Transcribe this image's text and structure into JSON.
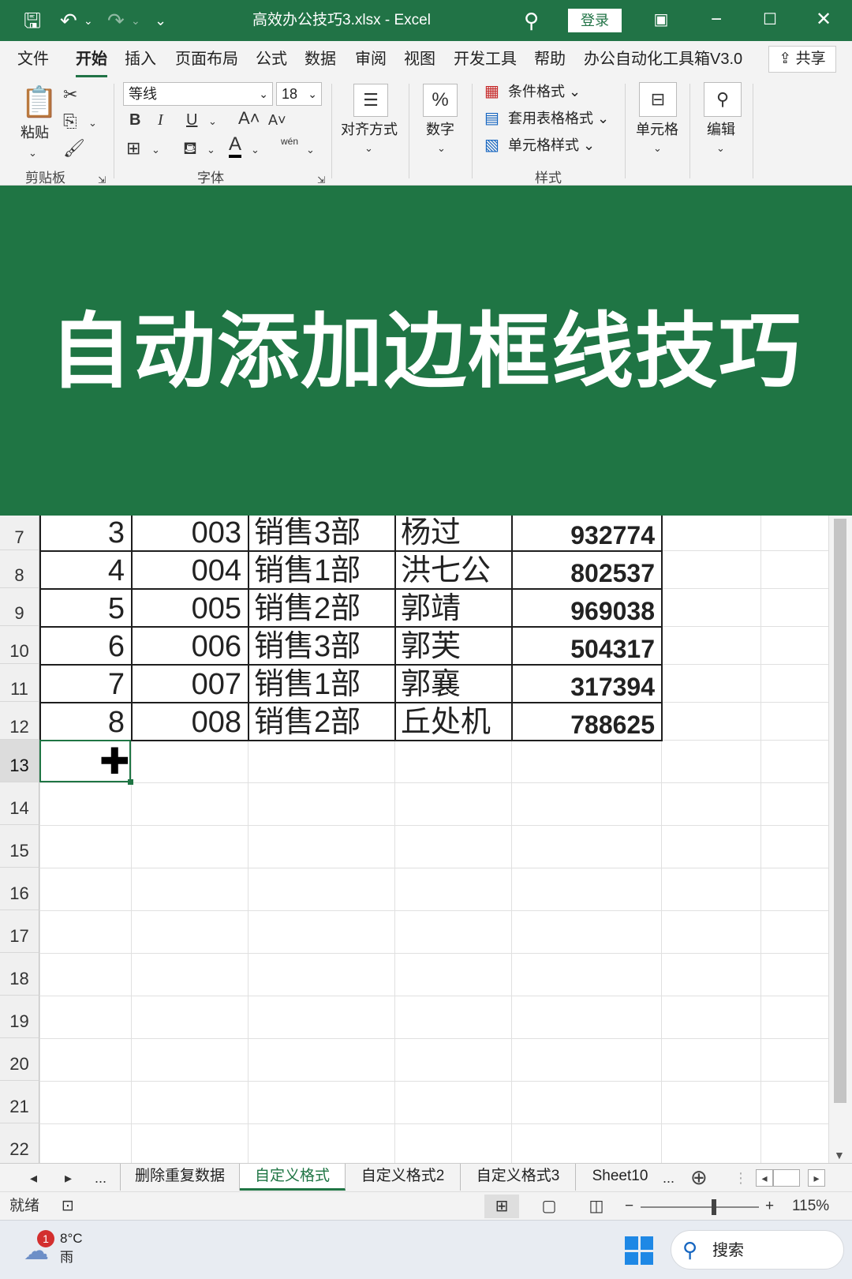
{
  "window": {
    "filename": "高效办公技巧3.xlsx",
    "separator": "-",
    "app_name": "Excel",
    "login_label": "登录"
  },
  "menu": {
    "tabs": [
      "文件",
      "开始",
      "插入",
      "页面布局",
      "公式",
      "数据",
      "审阅",
      "视图",
      "开发工具",
      "帮助",
      "办公自动化工具箱V3.0"
    ],
    "active_tab": "开始",
    "share_label": "共享"
  },
  "ribbon": {
    "paste_label": "粘贴",
    "clipboard_group": "剪贴板",
    "font_name": "等线",
    "font_size": "18",
    "bold": "B",
    "italic": "I",
    "underline": "U",
    "grow_font": "A˄",
    "shrink_font": "A˅",
    "font_color": "A",
    "phonetic": "wén",
    "font_group": "字体",
    "align_label": "对齐方式",
    "number_label": "数字",
    "number_symbol": "%",
    "cond_format": "条件格式",
    "table_format": "套用表格格式",
    "cell_style": "单元格样式",
    "styles_group": "样式",
    "cells_label": "单元格",
    "edit_label": "编辑"
  },
  "banner": {
    "title": "自动添加边框线技巧"
  },
  "sheet": {
    "rows": [
      {
        "row": "7",
        "seq": "3",
        "code": "003",
        "dept": "销售3部",
        "name": "杨过",
        "amount": "932774"
      },
      {
        "row": "8",
        "seq": "4",
        "code": "004",
        "dept": "销售1部",
        "name": "洪七公",
        "amount": "802537"
      },
      {
        "row": "9",
        "seq": "5",
        "code": "005",
        "dept": "销售2部",
        "name": "郭靖",
        "amount": "969038"
      },
      {
        "row": "10",
        "seq": "6",
        "code": "006",
        "dept": "销售3部",
        "name": "郭芙",
        "amount": "504317"
      },
      {
        "row": "11",
        "seq": "7",
        "code": "007",
        "dept": "销售1部",
        "name": "郭襄",
        "amount": "317394"
      },
      {
        "row": "12",
        "seq": "8",
        "code": "008",
        "dept": "销售2部",
        "name": "丘处机",
        "amount": "788625"
      }
    ],
    "empty_rows": [
      "13",
      "14",
      "15",
      "16",
      "17",
      "18",
      "19",
      "20",
      "21",
      "22"
    ],
    "selected_row": "13"
  },
  "sheet_tabs": {
    "ellipsis": "...",
    "tabs": [
      "删除重复数据",
      "自定义格式",
      "自定义格式2",
      "自定义格式3",
      "Sheet10"
    ],
    "active": "自定义格式",
    "more": "..."
  },
  "status": {
    "ready": "就绪",
    "zoom": "115%",
    "zoom_fraction": 0.62
  },
  "taskbar": {
    "notification_count": "1",
    "temperature": "8°C",
    "weather": "雨",
    "search_label": "搜索"
  },
  "colors": {
    "excel_green": "#217346",
    "banner_green": "#1f7544"
  }
}
